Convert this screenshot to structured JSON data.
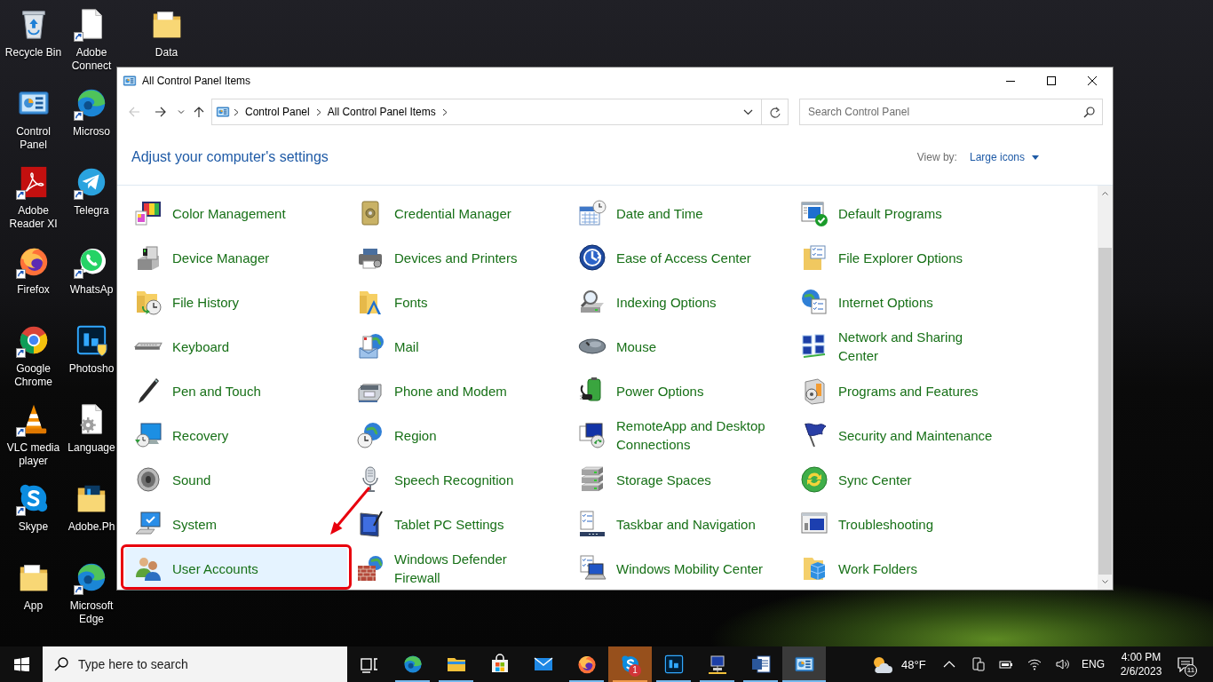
{
  "desktop_icons": [
    {
      "label": "Recycle Bin",
      "shortcut": false
    },
    {
      "label": "Control Panel",
      "shortcut": false
    },
    {
      "label": "Adobe Reader XI",
      "shortcut": true
    },
    {
      "label": "Firefox",
      "shortcut": true
    },
    {
      "label": "Google Chrome",
      "shortcut": true
    },
    {
      "label": "VLC media player",
      "shortcut": true
    },
    {
      "label": "Skype",
      "shortcut": true
    },
    {
      "label": "App",
      "shortcut": false
    },
    {
      "label": "Adobe Connect",
      "shortcut": true
    },
    {
      "label": "Microso",
      "shortcut": true
    },
    {
      "label": "Telegra",
      "shortcut": true
    },
    {
      "label": "WhatsAp",
      "shortcut": true
    },
    {
      "label": "Photosho",
      "shortcut": false
    },
    {
      "label": "Language",
      "shortcut": false
    },
    {
      "label": "Adobe.Ph",
      "shortcut": false
    },
    {
      "label": "Microsoft Edge",
      "shortcut": true
    },
    {
      "label": "Data",
      "shortcut": false
    }
  ],
  "window": {
    "title": "All Control Panel Items",
    "nav_buttons": [
      {
        "kind": "back",
        "disabled": true
      },
      {
        "kind": "forward",
        "disabled": false
      },
      {
        "kind": "recent",
        "disabled": false
      },
      {
        "kind": "up",
        "disabled": false
      }
    ],
    "breadcrumbs": [
      "Control Panel",
      "All Control Panel Items"
    ],
    "search": {
      "placeholder": "Search Control Panel"
    },
    "heading": "Adjust your computer's settings",
    "view_by": {
      "label": "View by:",
      "value": "Large icons"
    },
    "items": [
      {
        "label": "Color Management",
        "selected": false
      },
      {
        "label": "Credential Manager",
        "selected": false
      },
      {
        "label": "Date and Time",
        "selected": false
      },
      {
        "label": "Default Programs",
        "selected": false
      },
      {
        "label": "Device Manager",
        "selected": false
      },
      {
        "label": "Devices and Printers",
        "selected": false
      },
      {
        "label": "Ease of Access Center",
        "selected": false
      },
      {
        "label": "File Explorer Options",
        "selected": false
      },
      {
        "label": "File History",
        "selected": false
      },
      {
        "label": "Fonts",
        "selected": false
      },
      {
        "label": "Indexing Options",
        "selected": false
      },
      {
        "label": "Internet Options",
        "selected": false
      },
      {
        "label": "Keyboard",
        "selected": false
      },
      {
        "label": "Mail",
        "selected": false
      },
      {
        "label": "Mouse",
        "selected": false
      },
      {
        "label": "Network and Sharing Center",
        "selected": false
      },
      {
        "label": "Pen and Touch",
        "selected": false
      },
      {
        "label": "Phone and Modem",
        "selected": false
      },
      {
        "label": "Power Options",
        "selected": false
      },
      {
        "label": "Programs and Features",
        "selected": false
      },
      {
        "label": "Recovery",
        "selected": false
      },
      {
        "label": "Region",
        "selected": false
      },
      {
        "label": "RemoteApp and Desktop Connections",
        "selected": false
      },
      {
        "label": "Security and Maintenance",
        "selected": false
      },
      {
        "label": "Sound",
        "selected": false
      },
      {
        "label": "Speech Recognition",
        "selected": false
      },
      {
        "label": "Storage Spaces",
        "selected": false
      },
      {
        "label": "Sync Center",
        "selected": false
      },
      {
        "label": "System",
        "selected": false
      },
      {
        "label": "Tablet PC Settings",
        "selected": false
      },
      {
        "label": "Taskbar and Navigation",
        "selected": false
      },
      {
        "label": "Troubleshooting",
        "selected": false
      },
      {
        "label": "User Accounts",
        "selected": true
      },
      {
        "label": "Windows Defender Firewall",
        "selected": false
      },
      {
        "label": "Windows Mobility Center",
        "selected": false
      },
      {
        "label": "Work Folders",
        "selected": false
      }
    ]
  },
  "taskbar": {
    "search": {
      "placeholder": "Type here to search"
    },
    "apps": [
      {
        "selected": false,
        "running": true,
        "attention": false
      },
      {
        "selected": false,
        "running": true,
        "attention": false
      },
      {
        "selected": false,
        "running": false,
        "attention": false
      },
      {
        "selected": false,
        "running": false,
        "attention": false
      },
      {
        "selected": false,
        "running": true,
        "attention": false
      },
      {
        "selected": false,
        "running": true,
        "attention": true,
        "badge": "1"
      },
      {
        "selected": false,
        "running": true,
        "attention": false
      },
      {
        "selected": false,
        "running": true,
        "attention": false
      },
      {
        "selected": false,
        "running": true,
        "attention": false
      },
      {
        "selected": true,
        "running": true,
        "attention": false
      }
    ],
    "weather": {
      "temperature": "48°F"
    },
    "language": "ENG",
    "time": "4:00 PM",
    "date": "2/6/2023",
    "notifications": {
      "badge": "11"
    }
  }
}
